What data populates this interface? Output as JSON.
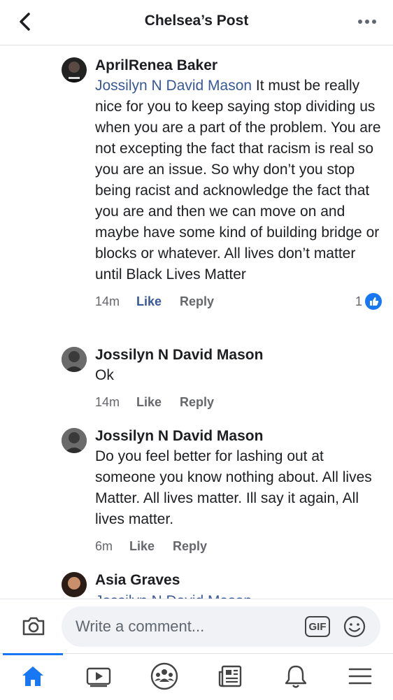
{
  "header": {
    "title": "Chelsea’s Post",
    "back_icon": "chevron-left-icon",
    "more_icon": "more-dots-icon"
  },
  "comments": [
    {
      "author": "AprilRenea Baker",
      "mention": "Jossilyn N David Mason",
      "text": " It must be really nice for you to keep saying stop dividing us when you are a part of the problem. You are not excepting the fact that racism is real so you are an issue. So why don’t you stop being racist and acknowledge the fact that you are and then we can move on and maybe have some kind of building bridge or blocks or whatever. All lives don’t matter until Black Lives Matter",
      "time": "14m",
      "like": "Like",
      "reply": "Reply",
      "reactions": "1",
      "liked": true
    },
    {
      "author": "Jossilyn N David Mason",
      "mention": "",
      "text": "Ok",
      "time": "14m",
      "like": "Like",
      "reply": "Reply"
    },
    {
      "author": "Jossilyn N David Mason",
      "mention": "",
      "text": "Do you feel better for lashing out at someone you know nothing about. All lives Matter. All lives matter. Ill say it again, All lives matter.",
      "time": "6m",
      "like": "Like",
      "reply": "Reply"
    },
    {
      "author": "Asia Graves",
      "mention": "Jossilyn N David Mason",
      "text": ""
    }
  ],
  "composer": {
    "placeholder": "Write a comment...",
    "gif_label": "GIF",
    "camera_icon": "camera-icon",
    "emoji_icon": "smiley-icon"
  },
  "tabs": [
    {
      "name": "home",
      "icon": "home-icon",
      "active": true
    },
    {
      "name": "watch",
      "icon": "video-play-icon"
    },
    {
      "name": "groups",
      "icon": "groups-icon"
    },
    {
      "name": "news",
      "icon": "newspaper-icon"
    },
    {
      "name": "notifications",
      "icon": "bell-icon"
    },
    {
      "name": "menu",
      "icon": "hamburger-menu-icon"
    }
  ],
  "colors": {
    "accent": "#1877f2",
    "link": "#385898",
    "muted": "#65676b"
  }
}
